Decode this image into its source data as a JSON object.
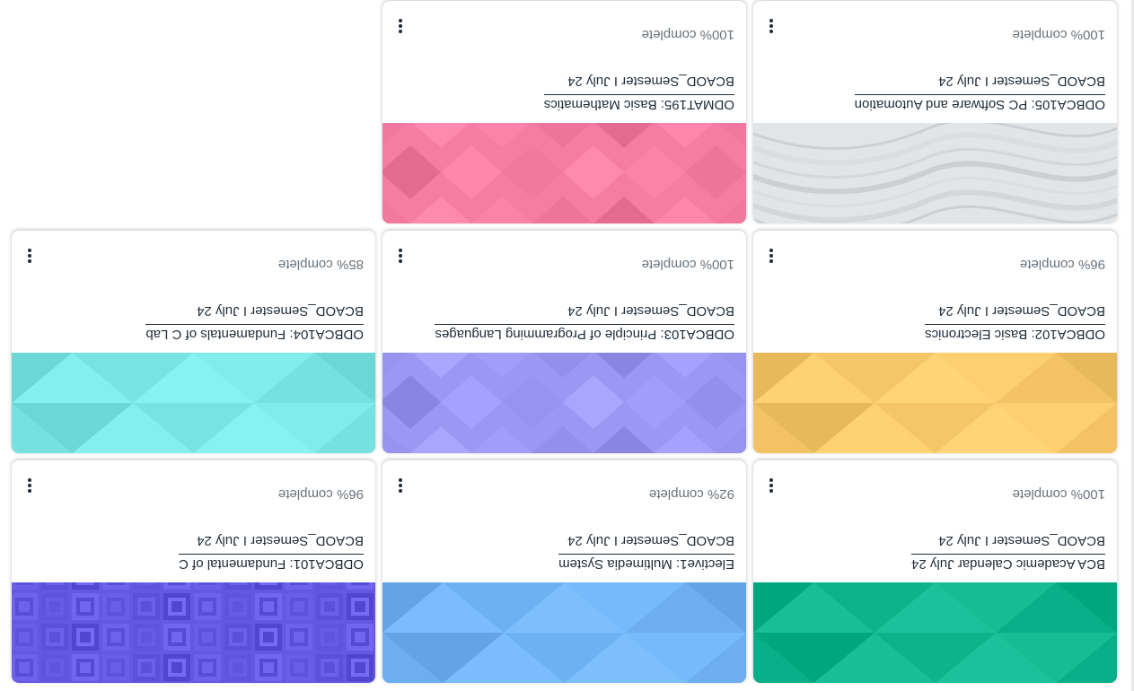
{
  "courses": [
    {
      "title": "BCA Academic Calendar July 24",
      "category": "BCAOD_Semester I July 24",
      "progress": "100% complete",
      "color": "#11b68f",
      "pattern": "triangles",
      "menu_icon": "kebab-menu-icon"
    },
    {
      "title": "Elective1: Multimedia System",
      "category": "BCAOD_Semester I July 24",
      "progress": "92% complete",
      "color": "#72b4f6",
      "pattern": "triangles",
      "menu_icon": "kebab-menu-icon"
    },
    {
      "title": "ODBCA101: Fundamental of C",
      "category": "BCAOD_Semester I July 24",
      "progress": "96% complete",
      "color": "#6259e0",
      "pattern": "squares",
      "menu_icon": "kebab-menu-icon"
    },
    {
      "title": "ODBCA102: Basic Electronics",
      "category": "BCAOD_Semester I July 24",
      "progress": "96% complete",
      "color": "#f8c96c",
      "pattern": "triangles",
      "menu_icon": "kebab-menu-icon"
    },
    {
      "title": "ODBCA103: Principle of Programming Languages",
      "category": "BCAOD_Semester I July 24",
      "progress": "100% complete",
      "color": "#9a98f2",
      "pattern": "diamonds",
      "menu_icon": "kebab-menu-icon"
    },
    {
      "title": "ODBCA104: Fundamentals of C Lab",
      "category": "BCAOD_Semester I July 24",
      "progress": "85% complete",
      "color": "#7de6e6",
      "pattern": "triangles",
      "menu_icon": "kebab-menu-icon"
    },
    {
      "title": "ODBCA105: PC Software and Automation",
      "category": "BCAOD_Semester I July 24",
      "progress": "100% complete",
      "color": "#e2e5e8",
      "pattern": "waves",
      "menu_icon": "kebab-menu-icon"
    },
    {
      "title": "ODMAT195: Basic Mathematics",
      "category": "BCAOD_Semester I July 24",
      "progress": "100% complete",
      "color": "#f57ca2",
      "pattern": "diamonds",
      "menu_icon": "kebab-menu-icon"
    }
  ]
}
